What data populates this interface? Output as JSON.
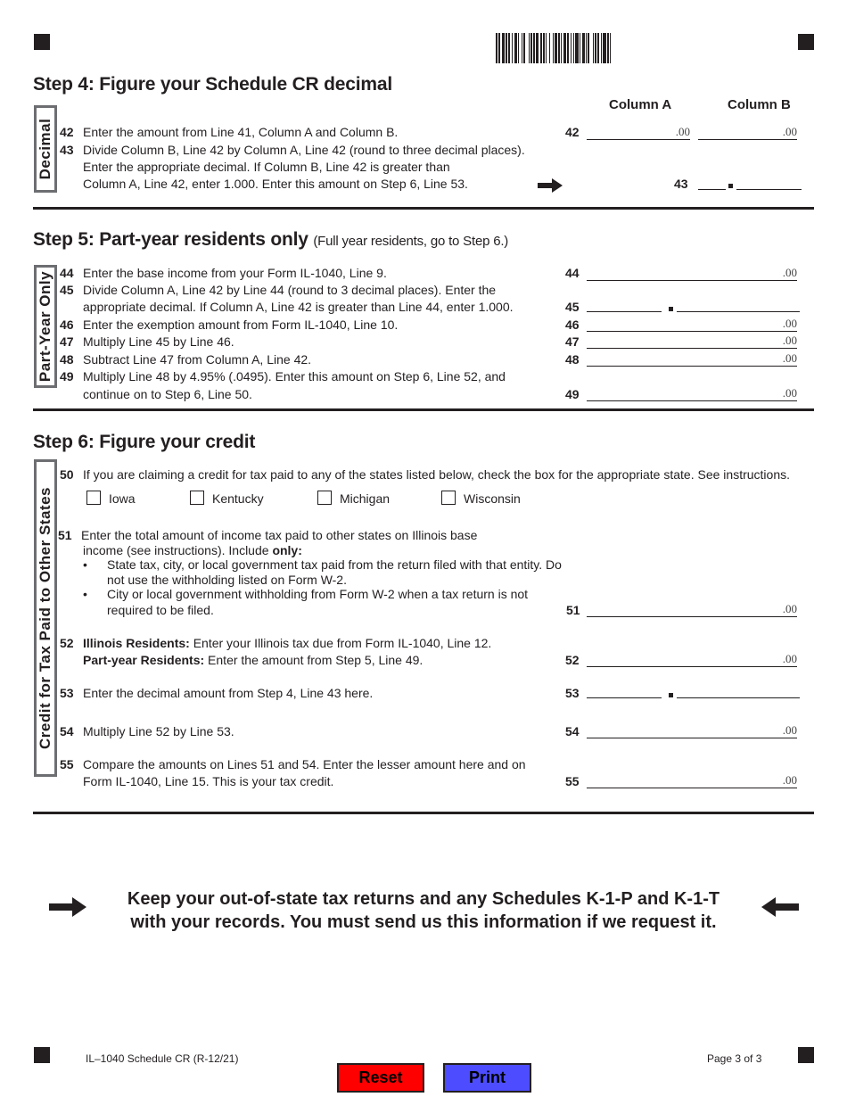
{
  "page": {
    "form_id": "IL–1040 Schedule CR (R-12/21)",
    "page_number": "Page 3 of 3"
  },
  "colors": {
    "reset_button": "#ff0000",
    "print_button": "#4d4dff",
    "ink": "#231f20",
    "side_box_border": "#6d6e71"
  },
  "step4": {
    "title": "Step  4: Figure your Schedule CR decimal",
    "side_label": "Decimal",
    "column_a": "Column A",
    "column_b": "Column B",
    "lines": [
      {
        "num": "42",
        "text": "Enter the amount from Line 41, Column A and Column B."
      },
      {
        "num": "43",
        "text": "Divide Column B, Line 42 by Column A, Line 42 (round to three decimal places)."
      }
    ],
    "line43_cont1": "Enter the appropriate decimal. If Column B, Line 42 is greater than",
    "line43_cont2": "Column A, Line 42, enter 1.000. Enter this amount on Step 6, Line 53.",
    "fields": {
      "f42_label": "42",
      "f42a_cents": ".00",
      "f42b_cents": ".00",
      "f43_label": "43"
    },
    "arrow_icon": "right-arrow"
  },
  "step5": {
    "title": "Step 5: Part-year residents only",
    "subtitle": "(Full year residents, go to Step 6.)",
    "side_label": "Part-Year Only",
    "lines": [
      {
        "num": "44",
        "text": "Enter the base income from your Form IL-1040, Line 9.",
        "label": "44",
        "cents": ".00"
      },
      {
        "num": "45",
        "text": "Divide Column A, Line 42 by Line 44 (round to 3 decimal places).  Enter the",
        "cont": "appropriate decimal. If Column A, Line 42 is greater than Line 44, enter 1.000.",
        "label": "45"
      },
      {
        "num": "46",
        "text": "Enter the exemption amount from Form IL-1040, Line 10.",
        "label": "46",
        "cents": ".00"
      },
      {
        "num": "47",
        "text": "Multiply Line 45 by Line 46.",
        "label": "47",
        "cents": ".00"
      },
      {
        "num": "48",
        "text": "Subtract Line 47 from Column A, Line 42.",
        "label": "48",
        "cents": ".00"
      },
      {
        "num": "49",
        "text": "Multiply Line 48 by 4.95% (.0495). Enter this amount on Step 6, Line 52, and",
        "cont": "continue on to Step 6, Line 50.",
        "label": "49",
        "cents": ".00"
      }
    ]
  },
  "step6": {
    "title": "Step 6: Figure your credit",
    "side_label": "Credit for Tax Paid to Other States",
    "line50": {
      "num": "50",
      "text": "If you are claiming a credit for tax paid to any of the states listed below, check the box for the appropriate state. See instructions.",
      "states": [
        "Iowa",
        "Kentucky",
        "Michigan",
        "Wisconsin"
      ]
    },
    "line51": {
      "num": "51",
      "text1": "Enter the total amount of income tax paid to other states on Illinois base",
      "text2_pre": "income (see instructions). Include ",
      "text2_bold": "only:",
      "bullet_char": "•",
      "bullet1_a": "State tax, city, or local government tax paid from the return filed with that entity. Do",
      "bullet1_b": "not use the withholding listed on Form W-2.",
      "bullet2_a": "City or local government withholding from Form W-2 when a tax return is not",
      "bullet2_b": "required to be filed.",
      "label": "51",
      "cents": ".00"
    },
    "line52": {
      "num": "52",
      "bold1": "Illinois Residents:",
      "text1": " Enter your Illinois tax due from Form IL-1040, Line 12.",
      "bold2": "Part-year Residents:",
      "text2": " Enter the amount from Step 5, Line 49.",
      "label": "52",
      "cents": ".00"
    },
    "line53": {
      "num": "53",
      "text": "Enter the decimal amount from Step 4, Line 43 here.",
      "label": "53"
    },
    "line54": {
      "num": "54",
      "text": "Multiply Line 52 by Line 53.",
      "label": "54",
      "cents": ".00"
    },
    "line55": {
      "num": "55",
      "text1": "Compare the amounts on Lines 51 and 54. Enter the lesser amount here and on",
      "text2": "Form IL-1040, Line 15. This is your tax credit.",
      "label": "55",
      "cents": ".00"
    }
  },
  "notice": {
    "line1": "Keep your out-of-state tax returns and any Schedules K-1-P and K-1-T",
    "line2": "with your records. You must send us this information if we request it.",
    "left_icon": "right-arrow",
    "right_icon": "left-arrow"
  },
  "buttons": {
    "reset": "Reset",
    "print": "Print"
  }
}
